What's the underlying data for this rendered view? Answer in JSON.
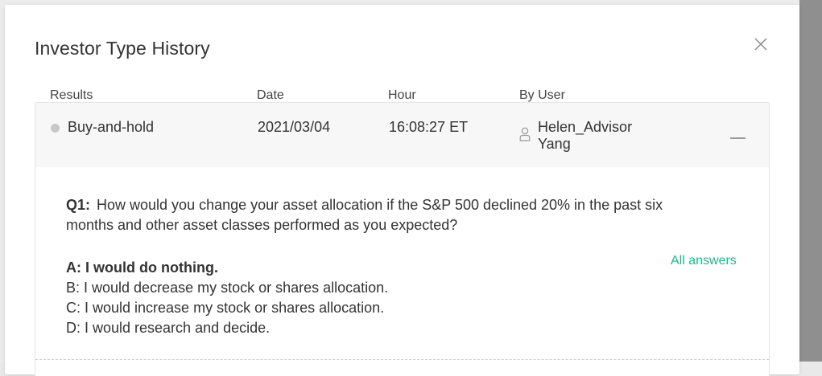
{
  "modal": {
    "title": "Investor Type History",
    "close_icon": "close-icon"
  },
  "table": {
    "headers": {
      "results": "Results",
      "date": "Date",
      "hour": "Hour",
      "by_user": "By User"
    },
    "row": {
      "result": "Buy-and-hold",
      "date": "2021/03/04",
      "hour": "16:08:27 ET",
      "user_line1": "Helen_Advisor",
      "user_line2": "Yang",
      "status_color": "#c8c8c8",
      "user_icon": "user-icon",
      "collapse_icon": "minus-icon"
    }
  },
  "detail": {
    "question_number": "Q1:",
    "question_text": "How would you change your asset allocation if the S&P 500 declined 20% in the past six months and other asset classes performed as you expected?",
    "all_answers_label": "All answers",
    "accent_color": "#21b58a",
    "answers": [
      "A: I would do nothing.",
      "B: I would decrease my stock or shares allocation.",
      "C: I would increase my stock or shares allocation.",
      "D: I would research and decide."
    ],
    "selected_answer_index": 0
  }
}
